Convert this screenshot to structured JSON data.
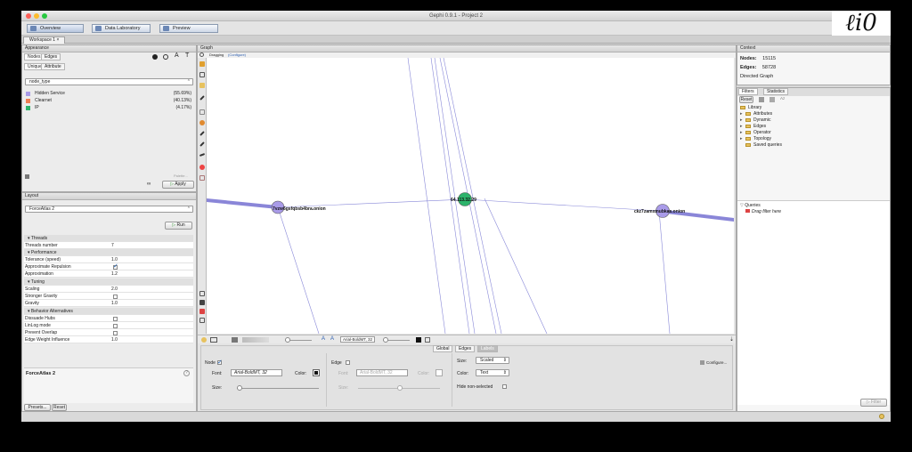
{
  "window": {
    "title": "Gephi 0.9.1 - Project 2",
    "workspace_tab": "Workspace 1"
  },
  "toolbar": {
    "overview": "Overview",
    "data_lab": "Data Laboratory",
    "preview": "Preview"
  },
  "appearance": {
    "title": "Appearance",
    "tab_nodes": "Nodes",
    "tab_edges": "Edges",
    "subtab_unique": "Unique",
    "subtab_attribute": "Attribute",
    "attribute_select": "node_type",
    "legend": [
      {
        "name": "Hidden Service",
        "pct": "(55.69%)",
        "color": "#a99be8"
      },
      {
        "name": "Clearnet",
        "pct": "(40.13%)",
        "color": "#ef7f54"
      },
      {
        "name": "IP",
        "pct": "(4.17%)",
        "color": "#2db36b"
      }
    ],
    "palette_link": "Palette...",
    "apply": "Apply"
  },
  "layout": {
    "title": "Layout",
    "algorithm": "ForceAtlas 2",
    "run": "Run",
    "sections": {
      "threads": "Threads",
      "performance": "Performance",
      "tuning": "Tuning",
      "behavior": "Behavior Alternatives"
    },
    "props": {
      "threads_number": {
        "k": "Threads number",
        "v": "7"
      },
      "tolerance": {
        "k": "Tolerance (speed)",
        "v": "1.0"
      },
      "approx_repulsion": {
        "k": "Approximate Repulsion"
      },
      "approximation": {
        "k": "Approximation",
        "v": "1.2"
      },
      "scaling": {
        "k": "Scaling",
        "v": "2.0"
      },
      "stronger_gravity": {
        "k": "Stronger Gravity"
      },
      "gravity": {
        "k": "Gravity",
        "v": "1.0"
      },
      "dissuade_hubs": {
        "k": "Dissuade Hubs"
      },
      "linlog": {
        "k": "LinLog mode"
      },
      "prevent_overlap": {
        "k": "Prevent Overlap"
      },
      "edge_weight": {
        "k": "Edge Weight Influence",
        "v": "1.0"
      }
    },
    "desc_title": "ForceAtlas 2",
    "presets": "Presets...",
    "reset": "Reset"
  },
  "graph": {
    "title": "Graph",
    "mode": "Dragging",
    "config": "(Configure)",
    "nodes": [
      {
        "label": "7vzw6gsfqbsb4bra.onion",
        "color": "#a99be8"
      },
      {
        "label": "64.113.32.29",
        "color": "#2db36b"
      },
      {
        "label": "ckz7zamxmubkas.onion",
        "color": "#a99be8"
      }
    ],
    "bottom_font": "Arial-BoldMT, 32"
  },
  "labels_panel": {
    "tab_global": "Global",
    "tab_edges": "Edges",
    "tab_labels": "Labels",
    "node_label": "Node",
    "edge_label": "Edge",
    "font_label": "Font:",
    "node_font": "Arial-BoldMT, 32",
    "edge_font": "Arial-BoldMT, 32",
    "color_label": "Color:",
    "size_label": "Size:",
    "size_mode": "Scaled",
    "color_mode": "Text",
    "hide_non_selected": "Hide non-selected",
    "configure": "Configure..."
  },
  "context": {
    "title": "Context",
    "nodes_label": "Nodes:",
    "nodes_value": "15115",
    "edges_label": "Edges:",
    "edges_value": "58728",
    "graph_type": "Directed Graph"
  },
  "filters": {
    "tab_filters": "Filters",
    "tab_statistics": "Statistics",
    "reset": "Reset",
    "library": "Library",
    "items": [
      "Attributes",
      "Dynamic",
      "Edges",
      "Operator",
      "Topology",
      "Saved queries"
    ],
    "queries": "Queries",
    "drag_hint": "Drag filter here",
    "filter_btn": "Filter"
  }
}
